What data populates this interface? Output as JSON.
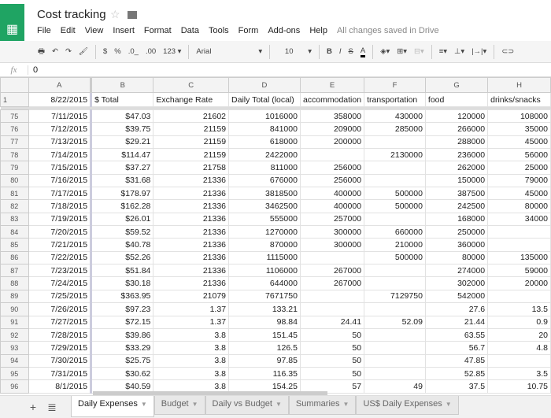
{
  "app": {
    "title": "Cost tracking",
    "status": "All changes saved in Drive"
  },
  "menu": [
    "File",
    "Edit",
    "View",
    "Insert",
    "Format",
    "Data",
    "Tools",
    "Form",
    "Add-ons",
    "Help"
  ],
  "toolbar": {
    "currency": "$",
    "percent": "%",
    "dec_less": ".0_",
    "dec_more": ".00",
    "more_formats": "123 ▾",
    "font": "Arial",
    "font_size": "10",
    "bold": "B",
    "italic": "I",
    "strike": "S",
    "text_color": "A"
  },
  "formula": {
    "label": "fx",
    "value": "0"
  },
  "columns": [
    "A",
    "B",
    "C",
    "D",
    "E",
    "F",
    "G",
    "H"
  ],
  "header_row": {
    "num": "1",
    "cells": [
      "8/22/2015",
      "$ Total",
      "Exchange Rate",
      "Daily Total (local)",
      "accommodation",
      "transportation",
      "food",
      "drinks/snacks"
    ]
  },
  "rows": [
    {
      "num": "75",
      "cells": [
        "7/11/2015",
        "$47.03",
        "21602",
        "1016000",
        "358000",
        "430000",
        "120000",
        "108000"
      ]
    },
    {
      "num": "76",
      "cells": [
        "7/12/2015",
        "$39.75",
        "21159",
        "841000",
        "209000",
        "285000",
        "266000",
        "35000"
      ]
    },
    {
      "num": "77",
      "cells": [
        "7/13/2015",
        "$29.21",
        "21159",
        "618000",
        "200000",
        "",
        "288000",
        "45000"
      ]
    },
    {
      "num": "78",
      "cells": [
        "7/14/2015",
        "$114.47",
        "21159",
        "2422000",
        "",
        "2130000",
        "236000",
        "56000"
      ]
    },
    {
      "num": "79",
      "cells": [
        "7/15/2015",
        "$37.27",
        "21758",
        "811000",
        "256000",
        "",
        "262000",
        "25000"
      ]
    },
    {
      "num": "80",
      "cells": [
        "7/16/2015",
        "$31.68",
        "21336",
        "676000",
        "256000",
        "",
        "150000",
        "79000"
      ]
    },
    {
      "num": "81",
      "cells": [
        "7/17/2015",
        "$178.97",
        "21336",
        "3818500",
        "400000",
        "500000",
        "387500",
        "45000"
      ]
    },
    {
      "num": "82",
      "cells": [
        "7/18/2015",
        "$162.28",
        "21336",
        "3462500",
        "400000",
        "500000",
        "242500",
        "80000"
      ]
    },
    {
      "num": "83",
      "cells": [
        "7/19/2015",
        "$26.01",
        "21336",
        "555000",
        "257000",
        "",
        "168000",
        "34000"
      ]
    },
    {
      "num": "84",
      "cells": [
        "7/20/2015",
        "$59.52",
        "21336",
        "1270000",
        "300000",
        "660000",
        "250000",
        ""
      ]
    },
    {
      "num": "85",
      "cells": [
        "7/21/2015",
        "$40.78",
        "21336",
        "870000",
        "300000",
        "210000",
        "360000",
        ""
      ]
    },
    {
      "num": "86",
      "cells": [
        "7/22/2015",
        "$52.26",
        "21336",
        "1115000",
        "",
        "500000",
        "80000",
        "135000"
      ]
    },
    {
      "num": "87",
      "cells": [
        "7/23/2015",
        "$51.84",
        "21336",
        "1106000",
        "267000",
        "",
        "274000",
        "59000"
      ]
    },
    {
      "num": "88",
      "cells": [
        "7/24/2015",
        "$30.18",
        "21336",
        "644000",
        "267000",
        "",
        "302000",
        "20000"
      ]
    },
    {
      "num": "89",
      "cells": [
        "7/25/2015",
        "$363.95",
        "21079",
        "7671750",
        "",
        "7129750",
        "542000",
        ""
      ]
    },
    {
      "num": "90",
      "cells": [
        "7/26/2015",
        "$97.23",
        "1.37",
        "133.21",
        "",
        "",
        "27.6",
        "13.5"
      ]
    },
    {
      "num": "91",
      "cells": [
        "7/27/2015",
        "$72.15",
        "1.37",
        "98.84",
        "24.41",
        "52.09",
        "21.44",
        "0.9"
      ]
    },
    {
      "num": "92",
      "cells": [
        "7/28/2015",
        "$39.86",
        "3.8",
        "151.45",
        "50",
        "",
        "63.55",
        "20"
      ]
    },
    {
      "num": "93",
      "cells": [
        "7/29/2015",
        "$33.29",
        "3.8",
        "126.5",
        "50",
        "",
        "56.7",
        "4.8"
      ]
    },
    {
      "num": "94",
      "cells": [
        "7/30/2015",
        "$25.75",
        "3.8",
        "97.85",
        "50",
        "",
        "47.85",
        ""
      ]
    },
    {
      "num": "95",
      "cells": [
        "7/31/2015",
        "$30.62",
        "3.8",
        "116.35",
        "50",
        "",
        "52.85",
        "3.5"
      ]
    },
    {
      "num": "96",
      "cells": [
        "8/1/2015",
        "$40.59",
        "3.8",
        "154.25",
        "57",
        "49",
        "37.5",
        "10.75"
      ]
    }
  ],
  "sheets": {
    "add": "+",
    "list": "≣",
    "tabs": [
      "Daily Expenses",
      "Budget",
      "Daily vs Budget",
      "Summaries",
      "US$ Daily Expenses"
    ],
    "active": 0
  },
  "colors": {
    "brand": "#1fa463"
  }
}
